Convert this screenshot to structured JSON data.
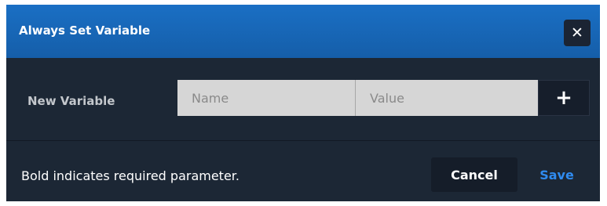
{
  "dialog": {
    "title": "Always Set Variable",
    "close_icon": "close-icon",
    "close_glyph": "✕"
  },
  "form": {
    "row_label": "New Variable",
    "name_placeholder": "Name",
    "value_placeholder": "Value",
    "add_icon": "plus-icon",
    "add_glyph": "+"
  },
  "footer": {
    "note": "Bold indicates required parameter.",
    "cancel_label": "Cancel",
    "save_label": "Save"
  },
  "colors": {
    "header_blue": "#1a6fc4",
    "dialog_bg": "#1c2735",
    "save_link": "#2f8bf0"
  }
}
